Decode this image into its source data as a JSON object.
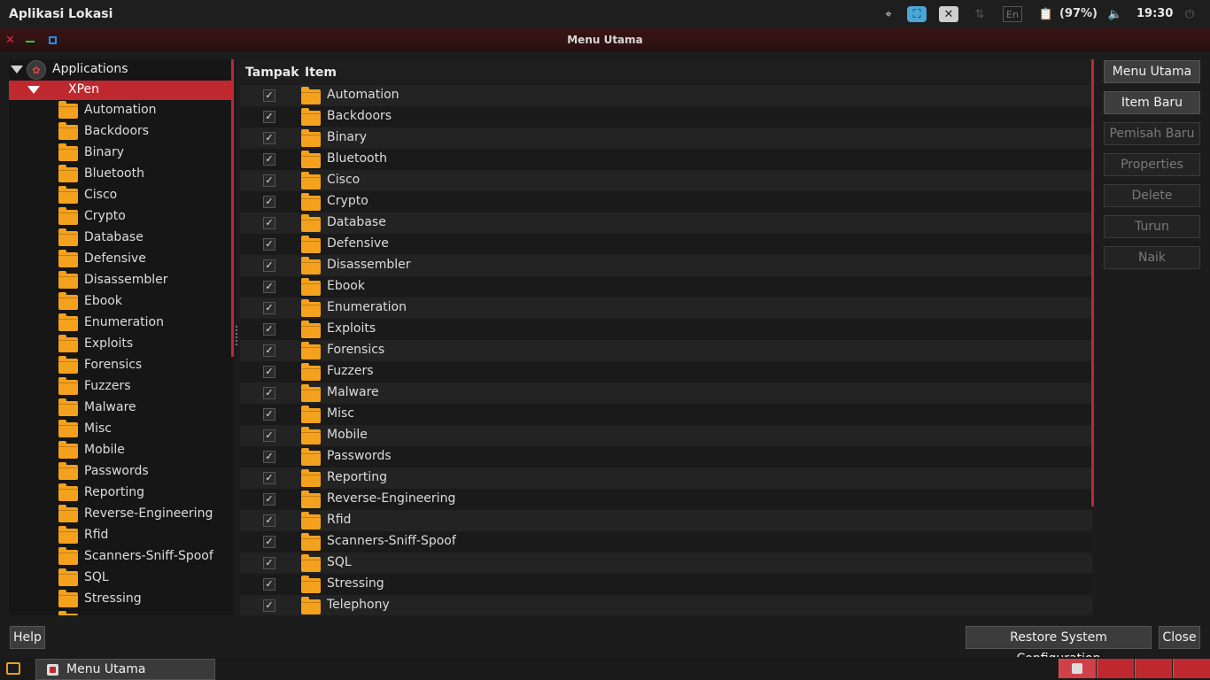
{
  "top_panel": {
    "menu_aplikasi": "Aplikasi",
    "menu_lokasi": "Lokasi",
    "battery_text": "(97%)",
    "clock": "19:30",
    "keyboard_layout": "En"
  },
  "window": {
    "title": "Menu Utama",
    "accent_color": "#c0282f"
  },
  "tree": {
    "root_label": "Applications",
    "selected_label": "XPen",
    "items": [
      "Automation",
      "Backdoors",
      "Binary",
      "Bluetooth",
      "Cisco",
      "Crypto",
      "Database",
      "Defensive",
      "Disassembler",
      "Ebook",
      "Enumeration",
      "Exploits",
      "Forensics",
      "Fuzzers",
      "Malware",
      "Misc",
      "Mobile",
      "Passwords",
      "Reporting",
      "Reverse-Engineering",
      "Rfid",
      "Scanners-Sniff-Spoof",
      "SQL",
      "Stressing"
    ]
  },
  "list": {
    "col_tampak": "Tampak",
    "col_item": "Item",
    "items": [
      "Automation",
      "Backdoors",
      "Binary",
      "Bluetooth",
      "Cisco",
      "Crypto",
      "Database",
      "Defensive",
      "Disassembler",
      "Ebook",
      "Enumeration",
      "Exploits",
      "Forensics",
      "Fuzzers",
      "Malware",
      "Misc",
      "Mobile",
      "Passwords",
      "Reporting",
      "Reverse-Engineering",
      "Rfid",
      "Scanners-Sniff-Spoof",
      "SQL",
      "Stressing",
      "Telephony"
    ],
    "checkmark": "✓"
  },
  "side_buttons": {
    "menu_utama": "Menu Utama",
    "item_baru": "Item Baru",
    "pemisah_baru": "Pemisah Baru",
    "properties": "Properties",
    "delete": "Delete",
    "turun": "Turun",
    "naik": "Naik"
  },
  "bottom": {
    "help": "Help",
    "restore": "Restore System Configuration",
    "close": "Close"
  },
  "taskbar": {
    "task_label": "Menu Utama"
  }
}
